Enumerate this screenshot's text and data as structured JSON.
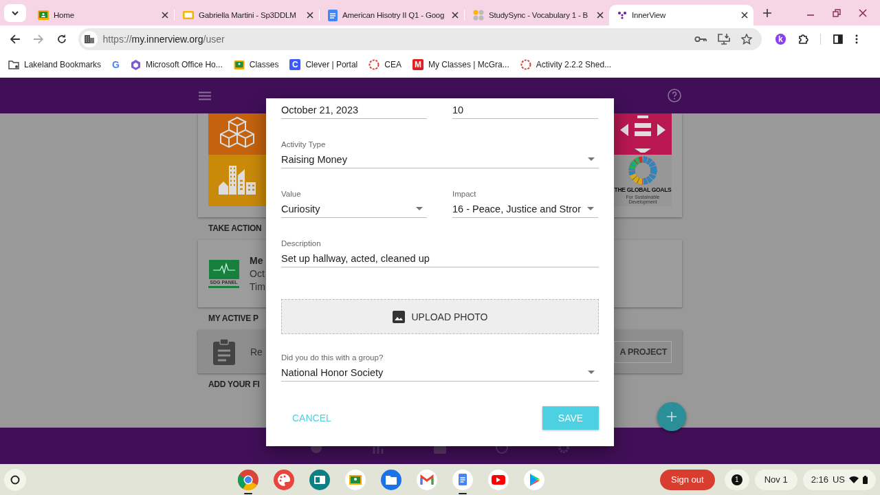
{
  "browser": {
    "tabs": [
      {
        "title": "Home",
        "kind": "classroom",
        "selected": false
      },
      {
        "title": "Gabriella Martini - Sp3DDLM",
        "kind": "slides",
        "selected": false
      },
      {
        "title": "American Hisotry II Q1 - Goog",
        "kind": "docs",
        "selected": false
      },
      {
        "title": "StudySync - Vocabulary 1 - B",
        "kind": "studysync",
        "selected": false
      },
      {
        "title": "InnerView",
        "kind": "innerview",
        "selected": true
      }
    ],
    "url": {
      "scheme": "https://",
      "host": "my.innerview.org",
      "path": "/user"
    },
    "extension_letter": "k",
    "bookmarks": [
      {
        "label": "Lakeland Bookmarks",
        "kind": "folder"
      },
      {
        "kind": "google",
        "icon_letter": "G"
      },
      {
        "label": "Microsoft Office Ho...",
        "kind": "office"
      },
      {
        "label": "Classes",
        "kind": "classroom"
      },
      {
        "label": "Clever | Portal",
        "kind": "letter",
        "icon_letter": "C"
      },
      {
        "label": "CEA",
        "kind": "ring"
      },
      {
        "label": "My Classes | McGra...",
        "kind": "letter",
        "icon_letter": "M"
      },
      {
        "label": "Activity 2.2.2 Shed...",
        "kind": "ring"
      }
    ]
  },
  "app": {
    "tiles_left": [
      {
        "kind": "cubes"
      },
      {
        "kind": "city"
      }
    ],
    "tiles_right": [
      {
        "kind": "arrows"
      },
      {
        "kind": "goals",
        "title": "THE GLOBAL GOALS",
        "subtitle": "For Sustainable Development"
      }
    ],
    "take_action": {
      "heading": "TAKE ACTION",
      "badge_text": "SDG PANEL",
      "title": "Me",
      "date": "Oct",
      "time": "Tim"
    },
    "active_projects": {
      "heading": "MY ACTIVE P",
      "text": "Re",
      "button": "A PROJECT"
    },
    "add_heading": "ADD YOUR FI",
    "bottom_nav": [
      {
        "kind": "circle"
      },
      {
        "kind": "bars"
      },
      {
        "kind": "image"
      },
      {
        "kind": "globe"
      },
      {
        "kind": "gear"
      }
    ]
  },
  "dialog": {
    "rows": [
      [
        {
          "kind": "text",
          "value": "October 21, 2023"
        },
        {
          "kind": "text",
          "value": "10"
        }
      ],
      [
        {
          "kind": "select",
          "label": "Activity Type",
          "value": "Raising Money"
        }
      ],
      [
        {
          "kind": "select",
          "label": "Value",
          "value": "Curiosity"
        },
        {
          "kind": "select",
          "label": "Impact",
          "value": "16 - Peace, Justice and Stror"
        }
      ],
      [
        {
          "kind": "text",
          "label": "Description",
          "value": "Set up hallway, acted, cleaned up"
        }
      ]
    ],
    "upload": "UPLOAD PHOTO",
    "group": {
      "kind": "select",
      "label": "Did you do this with a group?",
      "value": "National Honor Society"
    },
    "buttons": [
      {
        "label": "CANCEL",
        "kind": "flat"
      },
      {
        "label": "SAVE",
        "kind": "raised"
      }
    ]
  },
  "shelf": {
    "apps": [
      {
        "kind": "browser",
        "running": true
      },
      {
        "kind": "palette",
        "running": false
      },
      {
        "kind": "board",
        "running": false
      },
      {
        "kind": "classroom",
        "running": false
      },
      {
        "kind": "files",
        "running": false
      },
      {
        "kind": "mail",
        "running": false
      },
      {
        "kind": "docs",
        "running": true
      },
      {
        "kind": "video",
        "running": false
      },
      {
        "kind": "store",
        "running": false
      }
    ],
    "sign_out": "Sign out",
    "notifications": "1",
    "date": "Nov 1",
    "time": "2:16",
    "locale": "US"
  }
}
